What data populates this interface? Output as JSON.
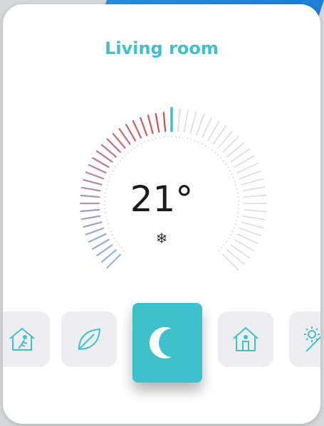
{
  "room": {
    "name": "Living room"
  },
  "thermostat": {
    "temperature": "21°",
    "mode_icon": "snowflake-icon",
    "mode_glyph": "❄"
  },
  "modes": [
    {
      "name": "away",
      "icon": "house-running-person-icon",
      "active": false
    },
    {
      "name": "eco",
      "icon": "leaf-icon",
      "active": false
    },
    {
      "name": "night",
      "icon": "moon-icon",
      "active": true
    },
    {
      "name": "home",
      "icon": "house-person-icon",
      "active": false
    },
    {
      "name": "day",
      "icon": "sun-icon",
      "active": false
    }
  ],
  "colors": {
    "accent": "#3fc1cc",
    "warm": "#e0473f",
    "cool": "#8fb4e8",
    "inactive_tick": "#dcdcdc"
  }
}
